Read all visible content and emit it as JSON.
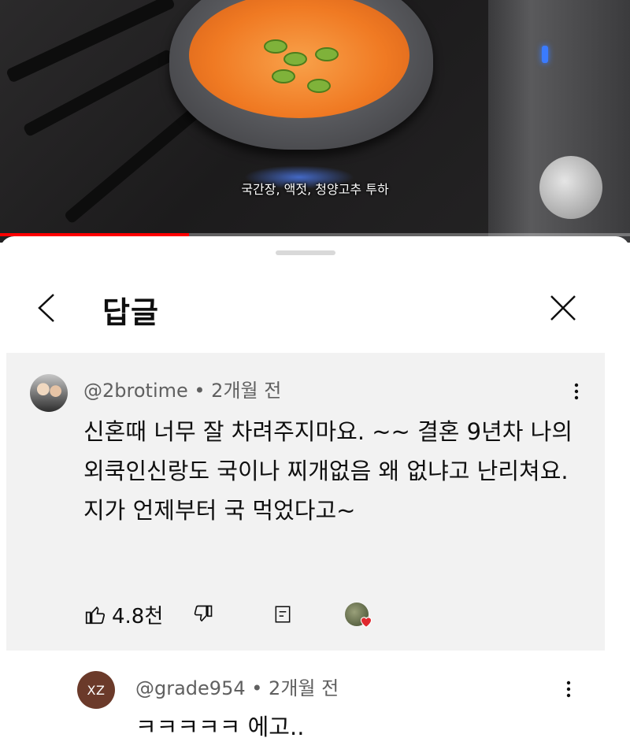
{
  "video": {
    "subtitle": "국간장, 액젓, 청양고추 투하",
    "progress_percent": 30
  },
  "sheet": {
    "title": "답글"
  },
  "comment": {
    "handle": "@2brotime",
    "separator": " • ",
    "time": "2개월 전",
    "text": "신혼때 너무  잘 차려주지마요. ~~  결혼 9년차 나의 외쿡인신랑도  국이나 찌개없음 왜 없냐고 난리쳐요. 지가 언제부터 국 먹었다고~",
    "likes": "4.8천"
  },
  "reply": {
    "avatar_initials": "XZ",
    "handle": "@grade954",
    "separator": " • ",
    "time": "2개월 전",
    "text": "ㅋㅋㅋㅋㅋ 에고.."
  },
  "colors": {
    "progress": "#ff0000",
    "comment_bg": "#f2f2f2",
    "heart": "#e0282e"
  }
}
